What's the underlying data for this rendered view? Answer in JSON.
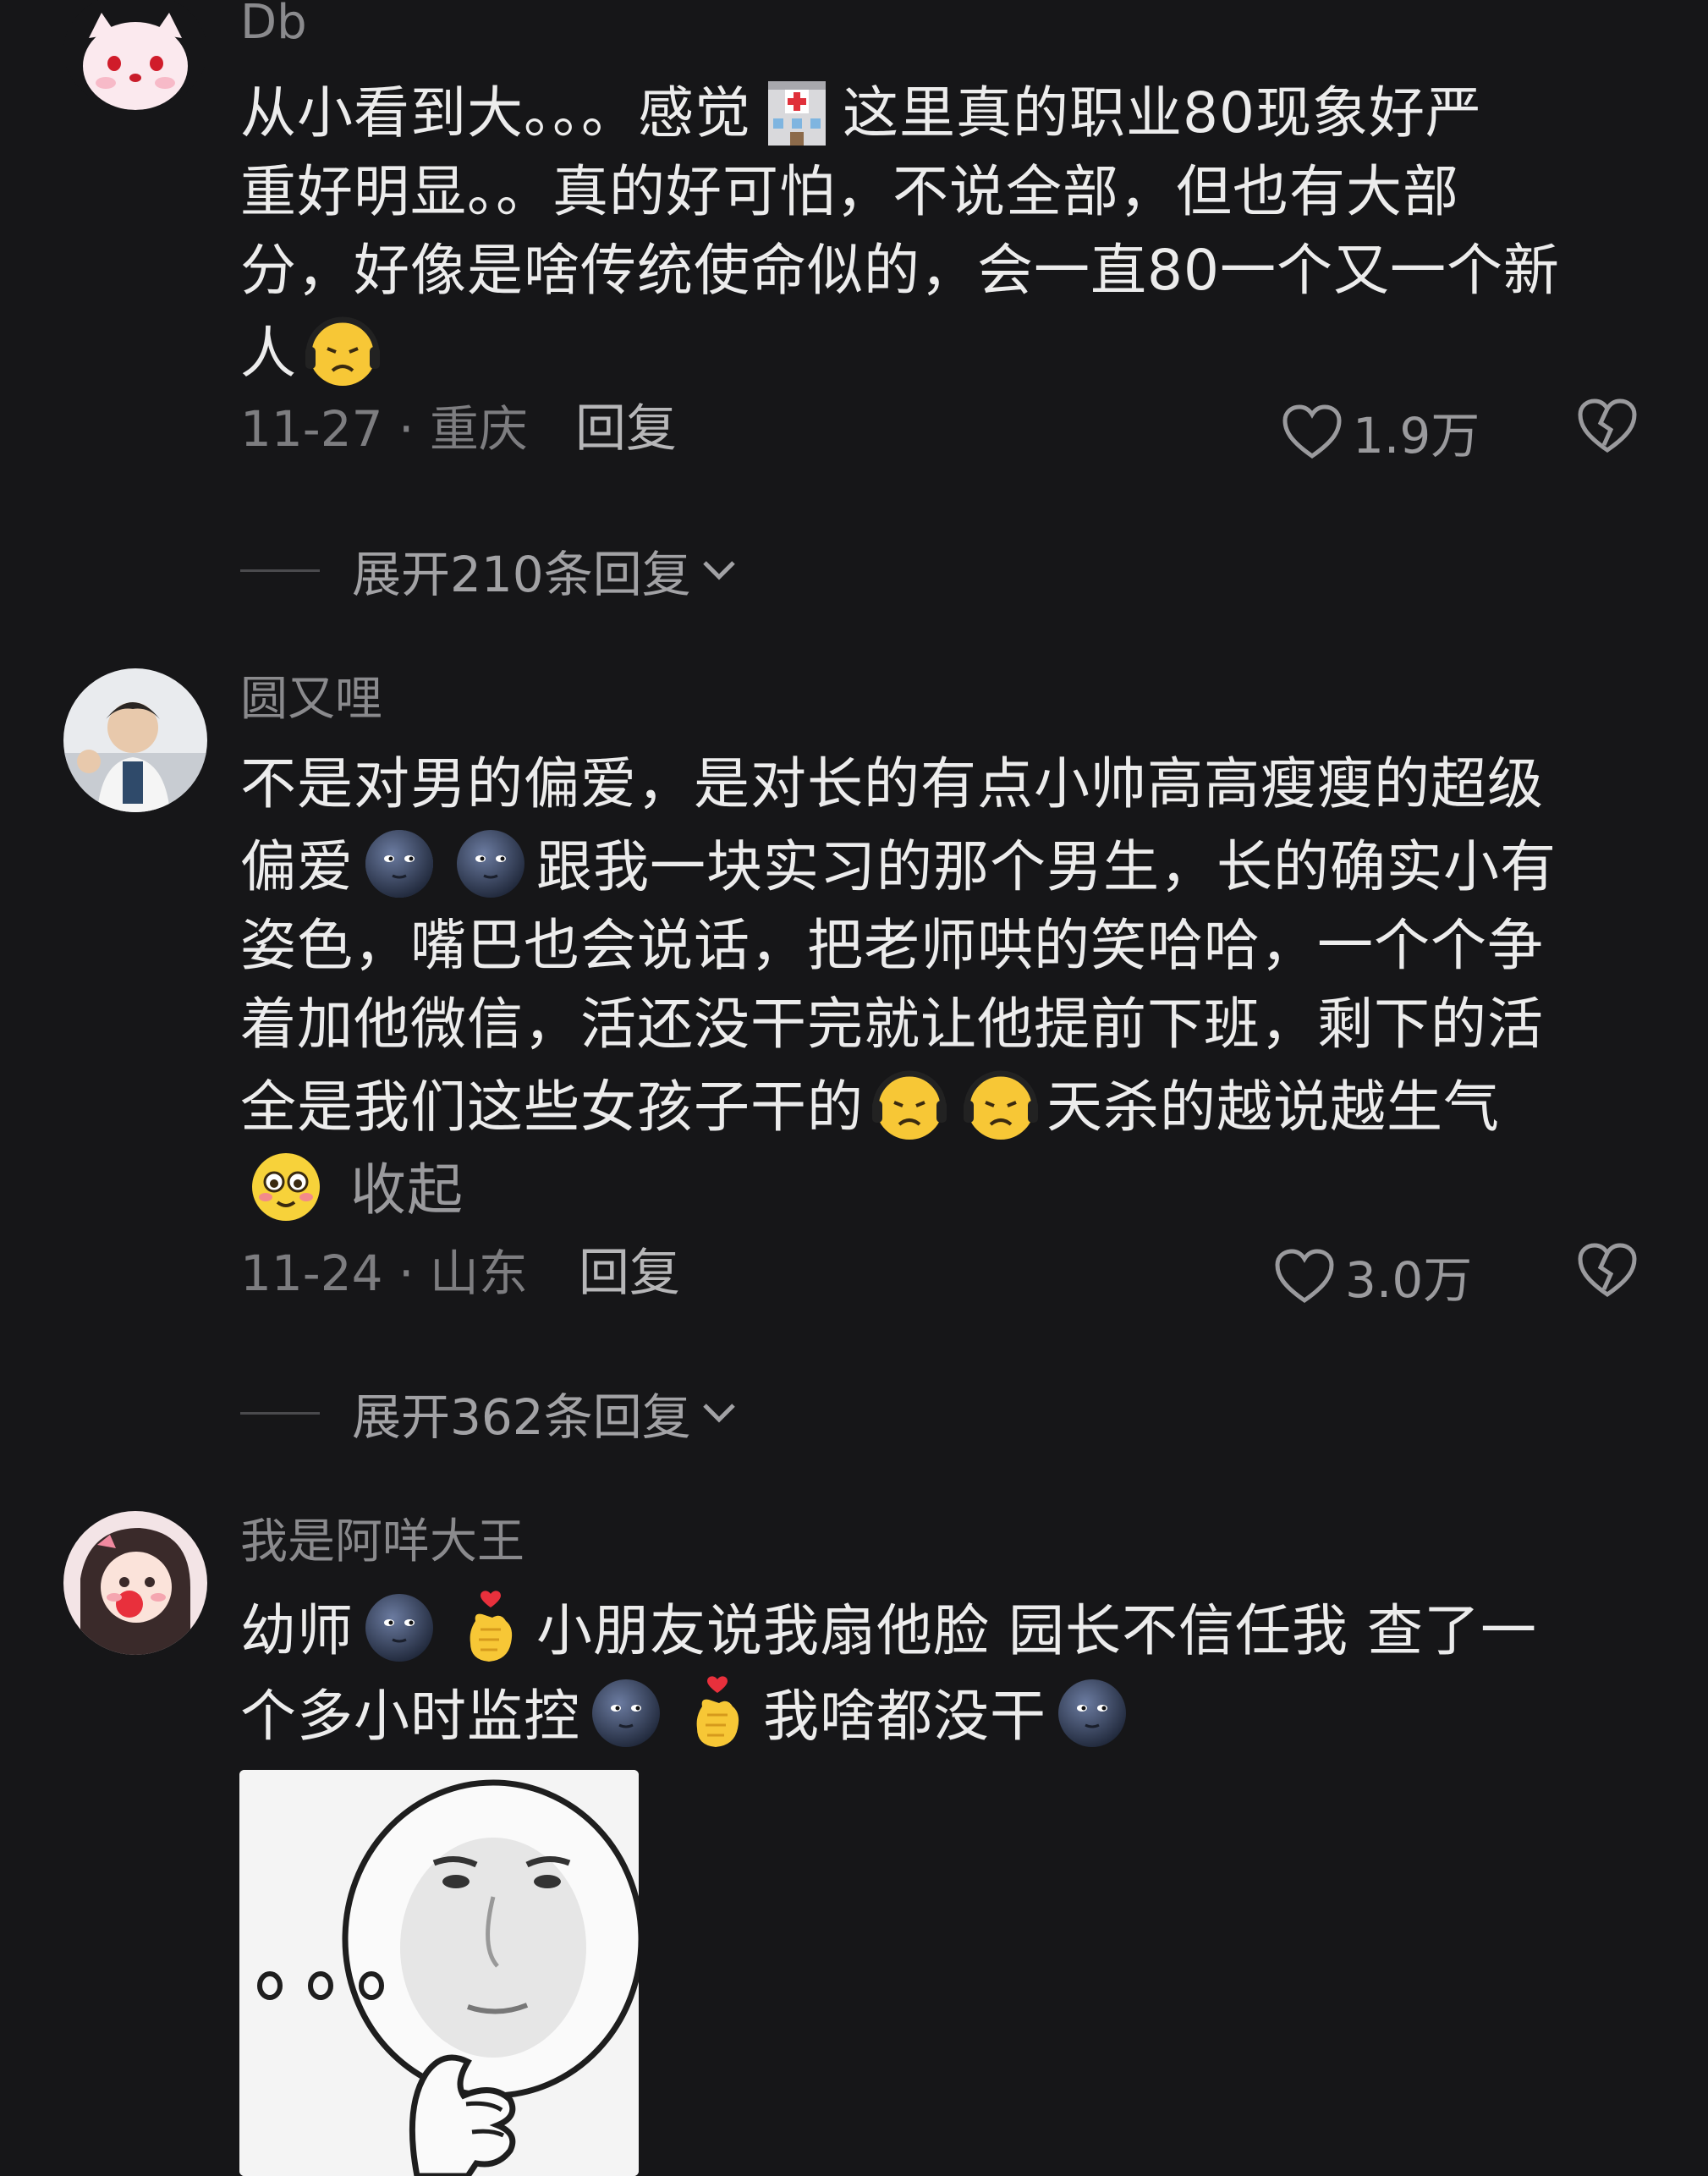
{
  "comments": [
    {
      "username": "Db",
      "text_lines": [
        [
          "从小看到大。。。感觉",
          "hospital",
          "这里真的职业80现象好严"
        ],
        [
          "重好明显。。真的好可怕，不说全部，但也有大部"
        ],
        [
          "分，好像是啥传统使命似的，会一直80一个又一个新"
        ],
        [
          "人",
          "sad"
        ]
      ],
      "date_location": "11-27 · 重庆",
      "reply_label": "回复",
      "likes": "1.9万",
      "expand_label": "展开210条回复"
    },
    {
      "username": "圆又哩",
      "text_lines": [
        [
          "不是对男的偏爱，是对长的有点小帅高高瘦瘦的超级"
        ],
        [
          "偏爱",
          "moon",
          "moon",
          "跟我一块实习的那个男生，长的确实小有"
        ],
        [
          "姿色，嘴巴也会说话，把老师哄的笑哈哈，一个个争"
        ],
        [
          "着加他微信，活还没干完就让他提前下班，剩下的活"
        ],
        [
          "全是我们这些女孩子干的",
          "sad",
          "sad",
          "天杀的越说越生气"
        ]
      ],
      "collapse_label": "收起",
      "date_location": "11-24 · 山东",
      "reply_label": "回复",
      "likes": "3.0万",
      "expand_label": "展开362条回复"
    },
    {
      "username": "我是阿咩大王",
      "text_lines": [
        [
          "幼师",
          "moon",
          "heart-hand",
          "小朋友说我扇他脸 园长不信任我 查了一"
        ],
        [
          "个多小时监控",
          "moon",
          "heart-hand",
          "我啥都没干",
          "moon"
        ]
      ]
    }
  ],
  "icons": {
    "like": "heart-outline-icon",
    "dislike": "broken-heart-icon",
    "expand": "chevron-down-icon"
  },
  "colors": {
    "background": "#161618",
    "text": "#ececec",
    "muted": "#8a8a8d"
  }
}
